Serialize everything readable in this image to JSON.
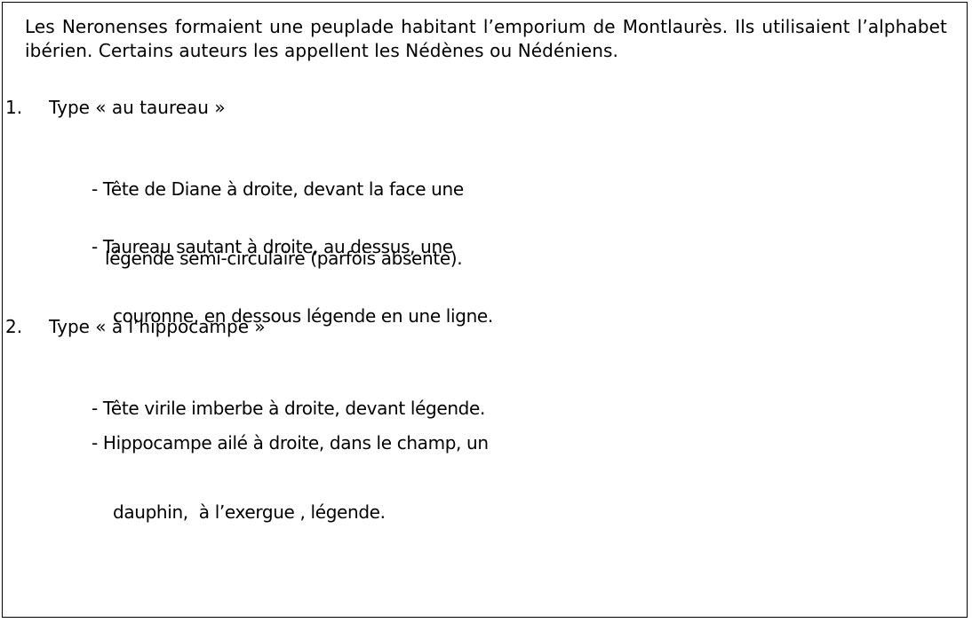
{
  "intro": {
    "text": "Les Neronenses formaient une peuplade habitant l’emporium de Montlaurès. Ils utilisaient l’alphabet ibérien. Certains auteurs les appellent les Nédènes ou Nédéniens."
  },
  "types": [
    {
      "number": "1.",
      "title": "Type « au taureau »",
      "items": [
        {
          "line1": "- Tête de Diane à droite, devant la face une",
          "line2": "légende semi-circulaire (parfois absente)."
        },
        {
          "line1": "- Taureau sautant à droite, au dessus, une",
          "line2": "couronne, en dessous légende en une ligne."
        }
      ]
    },
    {
      "number": "2.",
      "title": "Type « à l’hippocampe »",
      "items": [
        {
          "line1": "- Tête virile imberbe à droite, devant légende."
        },
        {
          "line1": "- Hippocampe ailé à droite, dans le champ, un",
          "line2": "dauphin,  à l’exergue , légende."
        }
      ]
    }
  ]
}
